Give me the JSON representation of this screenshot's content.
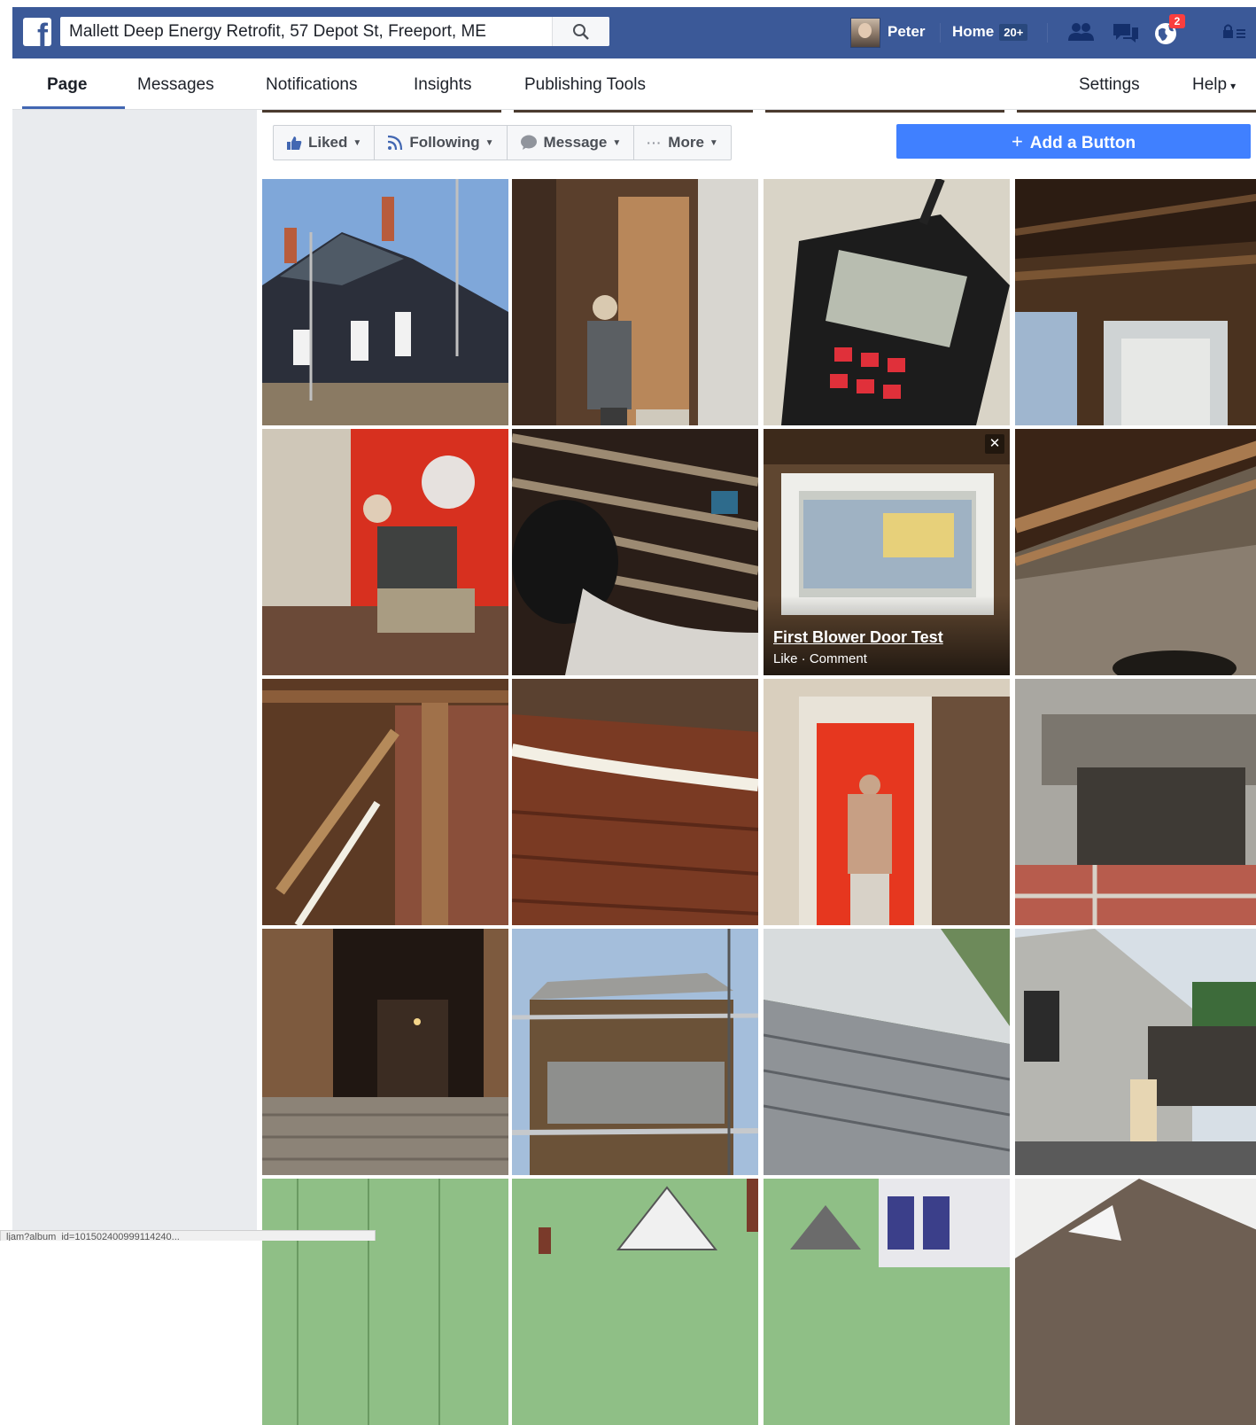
{
  "topbar": {
    "search_value": "Mallett Deep Energy Retrofit, 57 Depot St, Freeport, ME",
    "user_name": "Peter",
    "home_label": "Home",
    "home_count": "20+",
    "notifications_badge": "2",
    "brand_color": "#3b5998"
  },
  "pagenav": {
    "tabs": [
      {
        "label": "Page"
      },
      {
        "label": "Messages"
      },
      {
        "label": "Notifications"
      },
      {
        "label": "Insights"
      },
      {
        "label": "Publishing Tools"
      }
    ],
    "settings_label": "Settings",
    "help_label": "Help"
  },
  "actions": {
    "liked_label": "Liked",
    "following_label": "Following",
    "message_label": "Message",
    "more_label": "More",
    "add_button_label": "Add a Button",
    "add_button_color": "#4080ff"
  },
  "photos": {
    "hover_title": "First Blower Door Test",
    "hover_actions": "Like · Comment"
  },
  "status_bar": {
    "text": "ljam?album_id=101502400999114240..."
  }
}
